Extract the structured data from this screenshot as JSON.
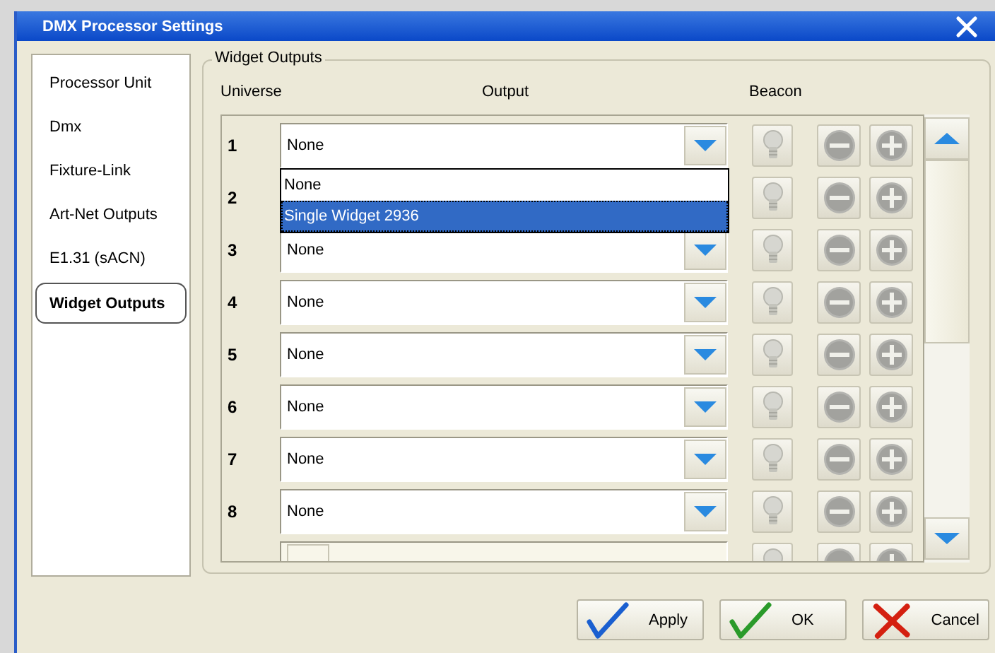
{
  "window": {
    "title": "DMX Processor Settings"
  },
  "nav": [
    {
      "label": "Processor Unit",
      "selected": false
    },
    {
      "label": "Dmx",
      "selected": false
    },
    {
      "label": "Fixture-Link",
      "selected": false
    },
    {
      "label": "Art-Net Outputs",
      "selected": false
    },
    {
      "label": "E1.31 (sACN)",
      "selected": false
    },
    {
      "label": "Widget Outputs",
      "selected": true
    }
  ],
  "group": {
    "title": "Widget Outputs",
    "columns": [
      "Universe",
      "Output",
      "Beacon"
    ]
  },
  "rows": [
    {
      "universe": "1",
      "output": "None",
      "expanded": true,
      "options": [
        {
          "label": "None",
          "selected": false
        },
        {
          "label": "Single Widget 2936",
          "selected": true
        }
      ]
    },
    {
      "universe": "2",
      "expanded": false
    },
    {
      "universe": "3",
      "output": "None",
      "expanded": false
    },
    {
      "universe": "4",
      "output": "None",
      "expanded": false
    },
    {
      "universe": "5",
      "output": "None",
      "expanded": false
    },
    {
      "universe": "6",
      "output": "None",
      "expanded": false
    },
    {
      "universe": "7",
      "output": "None",
      "expanded": false
    },
    {
      "universe": "8",
      "output": "None",
      "expanded": false
    },
    {
      "disabled": true,
      "expanded": false
    }
  ],
  "buttons": [
    {
      "label": "Apply",
      "kind": "apply"
    },
    {
      "label": "OK",
      "kind": "ok"
    },
    {
      "label": "Cancel",
      "kind": "cancel"
    }
  ]
}
